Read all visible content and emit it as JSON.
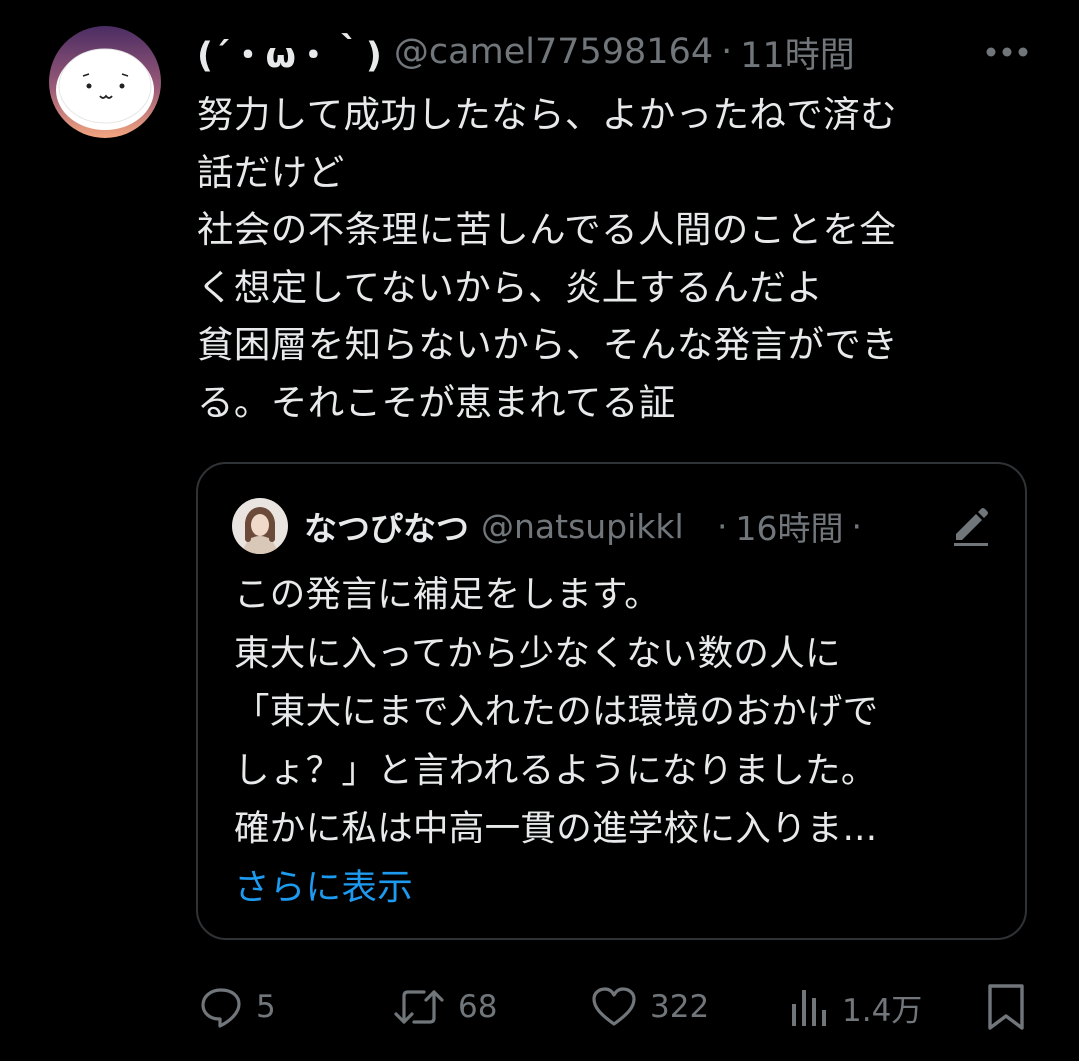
{
  "tweet": {
    "display_name": "(´・ω・｀)",
    "handle": "@camel77598164",
    "separator": "·",
    "time": "11時間",
    "text_lines": [
      "努力して成功したなら、よかったねで済む",
      "話だけど",
      "社会の不条理に苦しんでる人間のことを全",
      "く想定してないから、炎上するんだよ",
      "貧困層を知らないから、そんな発言ができ",
      "る。それこそが恵まれてる証"
    ]
  },
  "quote": {
    "display_name": "なつぴなつ",
    "handle": "@natsupikkl",
    "separator": "·",
    "time": "16時間",
    "separator2": "·",
    "text_lines": [
      "この発言に補足をします。",
      "東大に入ってから少なくない数の人に",
      "「東大にまで入れたのは環境のおかげで",
      "しょ？」と言われるようになりました。",
      "確かに私は中高一貫の進学校に入りま..."
    ],
    "show_more": "さらに表示"
  },
  "actions": {
    "reply_count": "5",
    "retweet_count": "68",
    "like_count": "322",
    "view_count": "1.4万"
  },
  "colors": {
    "background": "#000000",
    "text_primary": "#e7e9ea",
    "text_secondary": "#71767b",
    "link": "#1d9bf0",
    "border": "#2f3336"
  },
  "icons": {
    "more": "more-dots-icon",
    "edit": "pencil-edit-icon",
    "reply": "reply-bubble-icon",
    "retweet": "retweet-icon",
    "like": "heart-icon",
    "views": "bar-chart-icon",
    "bookmark": "bookmark-icon"
  }
}
